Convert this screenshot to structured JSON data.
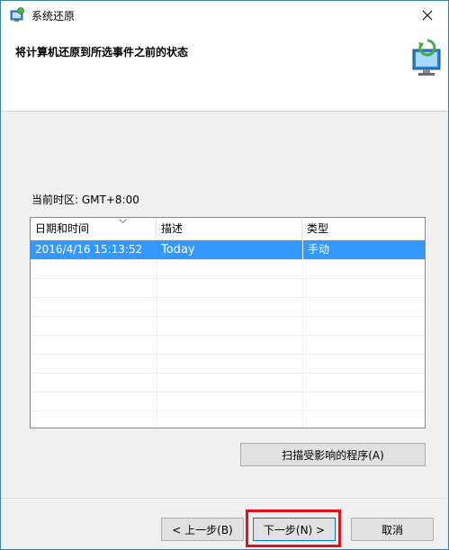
{
  "window": {
    "title": "系统还原"
  },
  "header": {
    "title": "将计算机还原到所选事件之前的状态"
  },
  "timezone": {
    "label": "当前时区: GMT+8:00"
  },
  "table": {
    "columns": [
      "日期和时间",
      "描述",
      "类型"
    ],
    "rows": [
      {
        "datetime": "2016/4/16 15:13:52",
        "description": "Today",
        "type": "手动",
        "selected": true
      }
    ]
  },
  "buttons": {
    "scan": "扫描受影响的程序(A)",
    "back": "< 上一步(B)",
    "next": "下一步(N) >",
    "cancel": "取消"
  },
  "colors": {
    "selection": "#3399ff",
    "highlight_box": "#e0131c",
    "window_border": "#3c7fb1"
  },
  "icons": [
    "system-restore-icon",
    "close-icon",
    "restore-monitor-icon",
    "sort-chevron-icon"
  ]
}
